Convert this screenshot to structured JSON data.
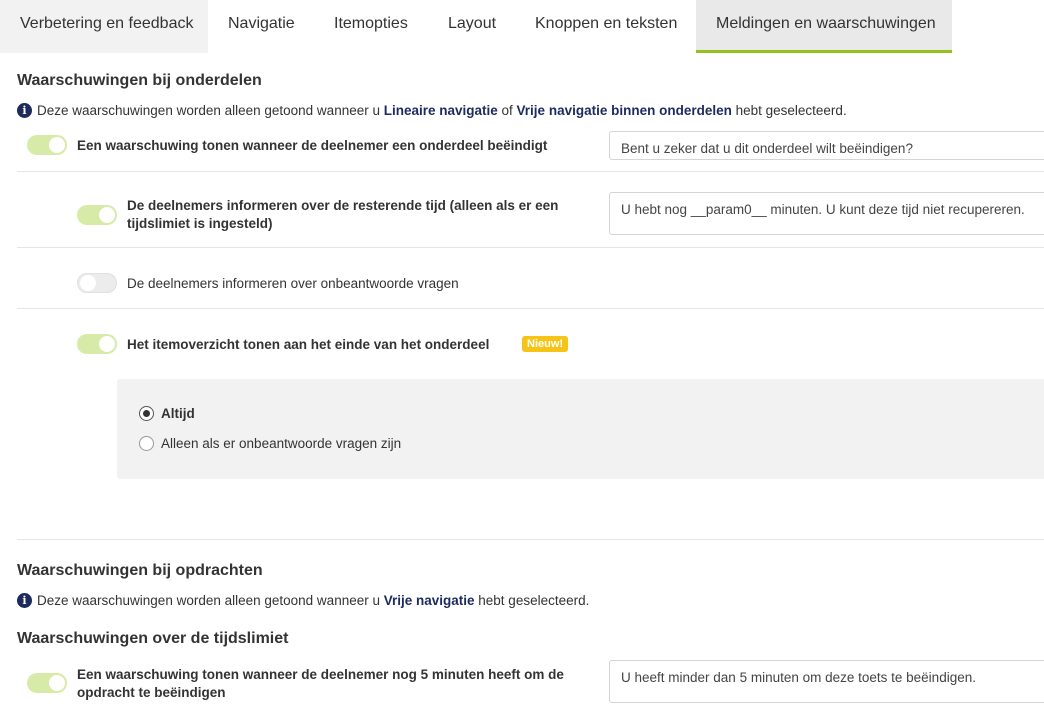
{
  "tabs": [
    {
      "label": "Verbetering en feedback"
    },
    {
      "label": "Navigatie"
    },
    {
      "label": "Itemopties"
    },
    {
      "label": "Layout"
    },
    {
      "label": "Knoppen en teksten"
    },
    {
      "label": "Meldingen en waarschuwingen",
      "active": true
    }
  ],
  "section1": {
    "title": "Waarschuwingen bij onderdelen",
    "info_prefix": "Deze waarschuwingen worden alleen getoond wanneer u ",
    "info_bold1": "Lineaire navigatie",
    "info_mid": " of ",
    "info_bold2": "Vrije navigatie binnen onderdelen",
    "info_suffix": " hebt geselecteerd.",
    "options": [
      {
        "label": "Een waarschuwing tonen wanneer de deelnemer een onderdeel beëindigt",
        "enabled": true,
        "value": "Bent u zeker dat u dit onderdeel wilt beëindigen?"
      },
      {
        "label": "De deelnemers informeren over de resterende tijd (alleen als er een tijdslimiet is ingesteld)",
        "enabled": true,
        "value": "U hebt nog __param0__ minuten. U kunt deze tijd niet recupereren."
      },
      {
        "label": "De deelnemers informeren over onbeantwoorde vragen",
        "enabled": false
      },
      {
        "label": "Het itemoverzicht tonen aan het einde van het onderdeel",
        "enabled": true,
        "badge": "Nieuw!"
      }
    ],
    "radios": [
      {
        "label": "Altijd",
        "checked": true
      },
      {
        "label": "Alleen als er onbeantwoorde vragen zijn",
        "checked": false
      }
    ]
  },
  "section2": {
    "title": "Waarschuwingen bij opdrachten",
    "info_prefix": "Deze waarschuwingen worden alleen getoond wanneer u ",
    "info_bold": "Vrije navigatie",
    "info_suffix": " hebt geselecteerd."
  },
  "section3": {
    "title": "Waarschuwingen over de tijdslimiet",
    "options": [
      {
        "label": "Een waarschuwing tonen wanneer de deelnemer nog 5 minuten heeft om de opdracht te beëindigen",
        "enabled": true,
        "value": "U heeft minder dan 5 minuten om deze toets te beëindigen."
      }
    ]
  },
  "colors": {
    "accent": "#95c11f",
    "toggle_on": "#d8eaa8",
    "badge": "#f6c416",
    "info": "#1c2a5e"
  }
}
